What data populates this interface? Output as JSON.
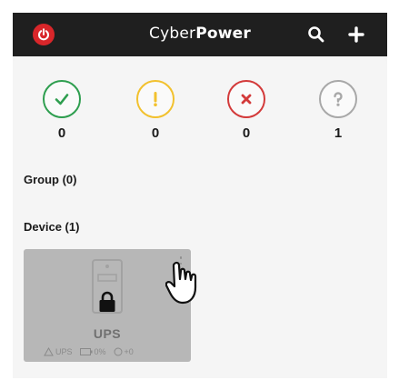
{
  "app": {
    "brand_light": "Cyber",
    "brand_bold": "Power"
  },
  "status_counts": [
    {
      "name": "normal",
      "icon": "check-icon",
      "color": "#2e9e4f",
      "count": "0"
    },
    {
      "name": "warning",
      "icon": "exclamation-icon",
      "color": "#f2c12e",
      "count": "0"
    },
    {
      "name": "critical",
      "icon": "x-icon",
      "color": "#d33a3a",
      "count": "0"
    },
    {
      "name": "unknown",
      "icon": "question-icon",
      "color": "#a8a8a8",
      "count": "1"
    }
  ],
  "groups": {
    "title": "Group (0)"
  },
  "devices": {
    "title": "Device (1)",
    "card": {
      "label": "UPS",
      "type": "UPS",
      "load": "0%",
      "extra": "+0"
    }
  }
}
